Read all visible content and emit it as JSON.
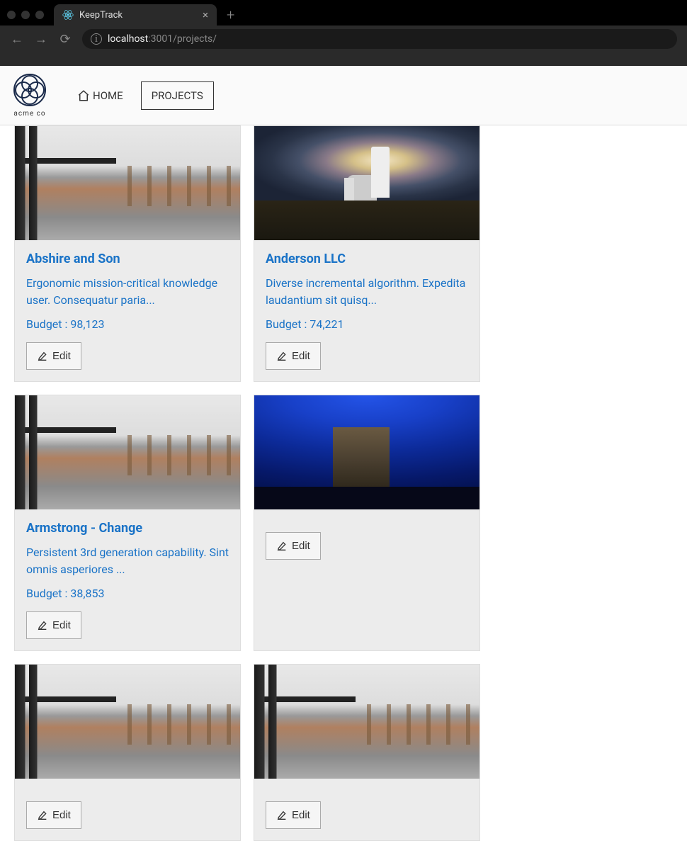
{
  "browser": {
    "tab_title": "KeepTrack",
    "url_host": "localhost",
    "url_port_path": ":3001/projects/"
  },
  "header": {
    "brand": "acme co",
    "nav": {
      "home": "HOME",
      "projects": "PROJECTS"
    }
  },
  "labels": {
    "budget_prefix": "Budget : ",
    "edit": "Edit"
  },
  "projects": [
    {
      "title": "Abshire and Son",
      "desc": "Ergonomic mission-critical knowledge user. Consequatur paria...",
      "budget": "98,123",
      "img": "walkway"
    },
    {
      "title": "Anderson LLC",
      "desc": "Diverse incremental algorithm. Expedita laudantium sit quisq...",
      "budget": "74,221",
      "img": "lighthouse"
    },
    {
      "title": "Armstrong - Change",
      "desc": "Persistent 3rd generation capability. Sint omnis asperiores ...",
      "budget": "38,853",
      "img": "walkway"
    },
    {
      "title": "",
      "desc": "",
      "budget": "",
      "img": "night"
    },
    {
      "title": "",
      "desc": "",
      "budget": "",
      "img": "walkway"
    },
    {
      "title": "",
      "desc": "",
      "budget": "",
      "img": "walkway"
    }
  ]
}
